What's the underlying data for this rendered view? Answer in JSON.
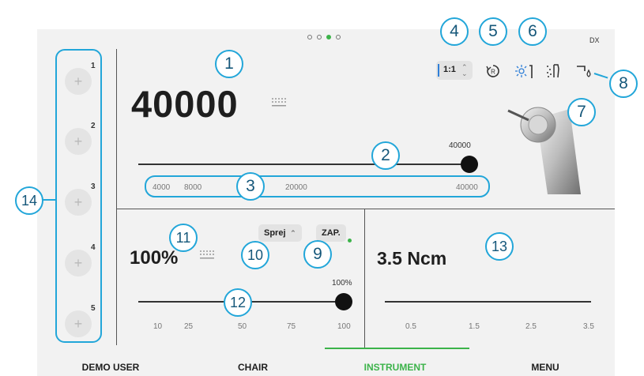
{
  "header": {
    "page_dots": [
      "inactive",
      "inactive",
      "active",
      "inactive"
    ],
    "side_label": "DX"
  },
  "toolbar": {
    "ratio": "1:1",
    "ratio_chevron": "⌃⌄",
    "icons": [
      "rotation-reverse-icon",
      "light-icon",
      "spray-icon",
      "water-drop-icon"
    ],
    "accent_color": "#2f7fd8"
  },
  "speed": {
    "value": "40000",
    "slider_label": "40000",
    "slider_fraction": 1.0,
    "presets": [
      "4000",
      "8000",
      "20000",
      "40000"
    ]
  },
  "slots": [
    {
      "number": "1",
      "icon": "+"
    },
    {
      "number": "2",
      "icon": "+"
    },
    {
      "number": "3",
      "icon": "+"
    },
    {
      "number": "4",
      "icon": "+"
    },
    {
      "number": "5",
      "icon": "+"
    }
  ],
  "spray": {
    "value": "100%",
    "mode_label": "Sprej",
    "toggle_label": "ZAP.",
    "slider_label": "100%",
    "slider_fraction": 1.0,
    "ticks": [
      "10",
      "25",
      "50",
      "75",
      "100"
    ]
  },
  "torque": {
    "value": "3.5 Ncm",
    "ticks": [
      "0.5",
      "1.5",
      "2.5",
      "3.5"
    ]
  },
  "callouts": [
    "1",
    "2",
    "3",
    "4",
    "5",
    "6",
    "7",
    "8",
    "9",
    "10",
    "11",
    "12",
    "13",
    "14"
  ],
  "nav": {
    "items": [
      "DEMO USER",
      "CHAIR",
      "INSTRUMENT",
      "MENU"
    ],
    "active": "INSTRUMENT",
    "active_color": "#3cb34a"
  }
}
